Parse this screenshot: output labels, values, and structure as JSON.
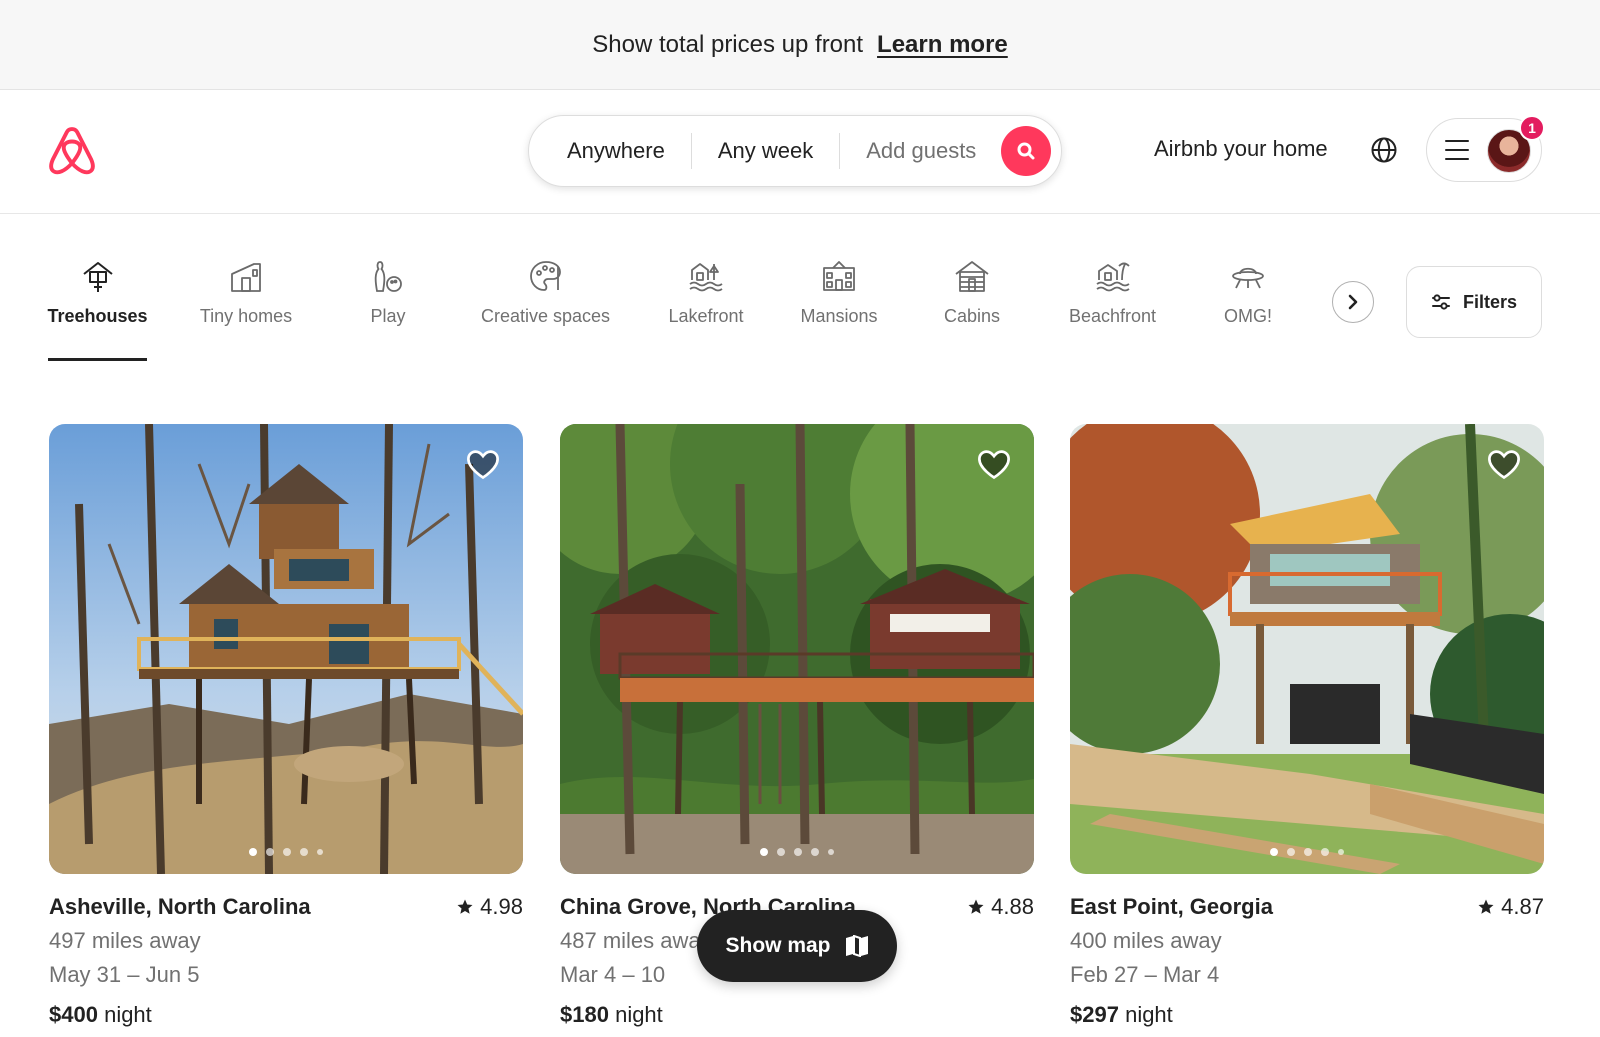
{
  "banner": {
    "message": "Show total prices up front",
    "link": "Learn more"
  },
  "header": {
    "search": {
      "where": "Anywhere",
      "when": "Any week",
      "guests": "Add guests"
    },
    "host_link": "Airbnb your home",
    "notification_count": "1"
  },
  "categories": [
    {
      "label": "Treehouses",
      "icon": "treehouse-icon",
      "active": true
    },
    {
      "label": "Tiny homes",
      "icon": "tiny-home-icon"
    },
    {
      "label": "Play",
      "icon": "bowling-icon"
    },
    {
      "label": "Creative spaces",
      "icon": "palette-icon"
    },
    {
      "label": "Lakefront",
      "icon": "lakefront-icon"
    },
    {
      "label": "Mansions",
      "icon": "mansion-icon"
    },
    {
      "label": "Cabins",
      "icon": "cabin-icon"
    },
    {
      "label": "Beachfront",
      "icon": "beachfront-icon"
    },
    {
      "label": "OMG!",
      "icon": "ufo-icon"
    }
  ],
  "filters_label": "Filters",
  "listings": [
    {
      "location": "Asheville, North Carolina",
      "rating": "4.98",
      "distance": "497 miles away",
      "dates": "May 31 – Jun 5",
      "price": "$400",
      "price_unit": "night"
    },
    {
      "location": "China Grove, North Carolina",
      "rating": "4.88",
      "distance": "487 miles away",
      "dates": "Mar 4 – 10",
      "price": "$180",
      "price_unit": "night"
    },
    {
      "location": "East Point, Georgia",
      "rating": "4.87",
      "distance": "400 miles away",
      "dates": "Feb 27 – Mar 4",
      "price": "$297",
      "price_unit": "night"
    }
  ],
  "show_map_label": "Show map",
  "colors": {
    "brand": "#ff385c",
    "text": "#222222",
    "muted": "#717171"
  }
}
